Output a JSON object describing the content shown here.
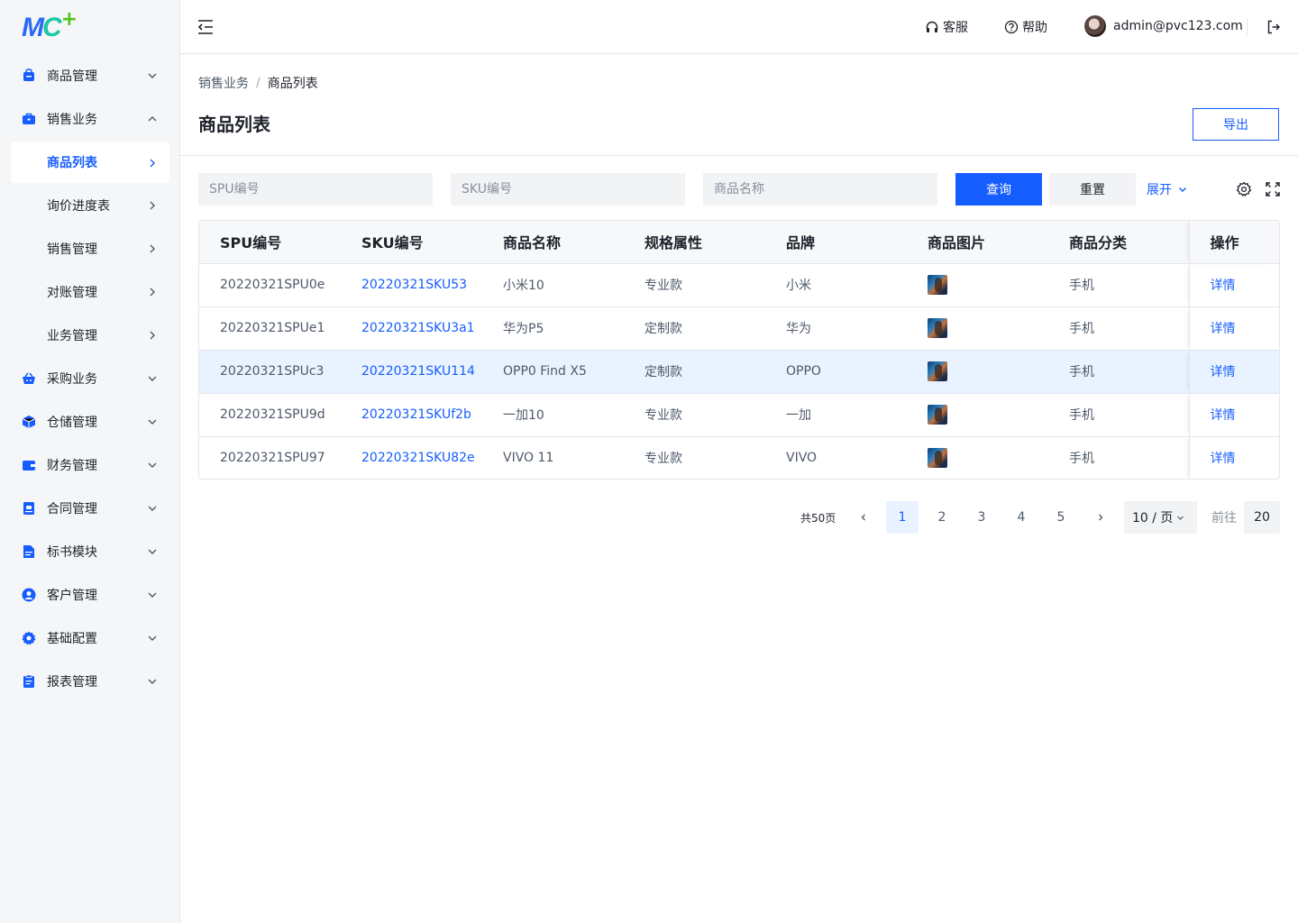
{
  "logo": {
    "text_m": "M",
    "text_c": "C",
    "plus": "+"
  },
  "sidebar": {
    "items": [
      {
        "label": "商品管理",
        "icon": "bag-icon",
        "expanded": false
      },
      {
        "label": "销售业务",
        "icon": "briefcase-icon",
        "expanded": true,
        "children": [
          {
            "label": "商品列表",
            "active": true
          },
          {
            "label": "询价进度表"
          },
          {
            "label": "销售管理"
          },
          {
            "label": "对账管理"
          },
          {
            "label": "业务管理"
          }
        ]
      },
      {
        "label": "采购业务",
        "icon": "basket-icon",
        "expanded": false
      },
      {
        "label": "仓储管理",
        "icon": "box-icon",
        "expanded": false
      },
      {
        "label": "财务管理",
        "icon": "wallet-icon",
        "expanded": false
      },
      {
        "label": "合同管理",
        "icon": "contract-icon",
        "expanded": false
      },
      {
        "label": "标书模块",
        "icon": "document-icon",
        "expanded": false
      },
      {
        "label": "客户管理",
        "icon": "user-icon",
        "expanded": false
      },
      {
        "label": "基础配置",
        "icon": "gear-icon",
        "expanded": false
      },
      {
        "label": "报表管理",
        "icon": "clipboard-icon",
        "expanded": false
      }
    ]
  },
  "header": {
    "service": "客服",
    "help": "帮助",
    "user_email": "admin@pvc123.com"
  },
  "breadcrumb": {
    "parent": "销售业务",
    "separator": "/",
    "current": "商品列表"
  },
  "page": {
    "title": "商品列表",
    "export_label": "导出"
  },
  "filters": {
    "spu_placeholder": "SPU编号",
    "sku_placeholder": "SKU编号",
    "name_placeholder": "商品名称",
    "query_label": "查询",
    "reset_label": "重置",
    "expand_label": "展开"
  },
  "table": {
    "columns": [
      "SPU编号",
      "SKU编号",
      "商品名称",
      "规格属性",
      "品牌",
      "商品图片",
      "商品分类",
      "操作"
    ],
    "rows": [
      {
        "spu": "20220321SPU0e",
        "sku": "20220321SKU53",
        "name": "小米10",
        "spec": "专业款",
        "brand": "小米",
        "category": "手机",
        "action": "详情"
      },
      {
        "spu": "20220321SPUe1",
        "sku": "20220321SKU3a1",
        "name": "华为P5",
        "spec": "定制款",
        "brand": "华为",
        "category": "手机",
        "action": "详情"
      },
      {
        "spu": "20220321SPUc3",
        "sku": "20220321SKU114",
        "name": "OPP0 Find X5",
        "spec": "定制款",
        "brand": "OPPO",
        "category": "手机",
        "action": "详情",
        "highlighted": true
      },
      {
        "spu": "20220321SPU9d",
        "sku": "20220321SKUf2b",
        "name": "一加10",
        "spec": "专业款",
        "brand": "一加",
        "category": "手机",
        "action": "详情"
      },
      {
        "spu": "20220321SPU97",
        "sku": "20220321SKU82e",
        "name": "VIVO 11",
        "spec": "专业款",
        "brand": "VIVO",
        "category": "手机",
        "action": "详情"
      }
    ]
  },
  "pagination": {
    "total_label": "共50页",
    "pages": [
      "1",
      "2",
      "3",
      "4",
      "5"
    ],
    "current": "1",
    "page_size": "10 / 页",
    "goto_label": "前往",
    "goto_value": "20"
  },
  "colors": {
    "primary": "#165dff",
    "sidebar_bg": "#f5f6f8",
    "row_highlight": "#e8f3ff",
    "border": "#e5e6eb"
  }
}
